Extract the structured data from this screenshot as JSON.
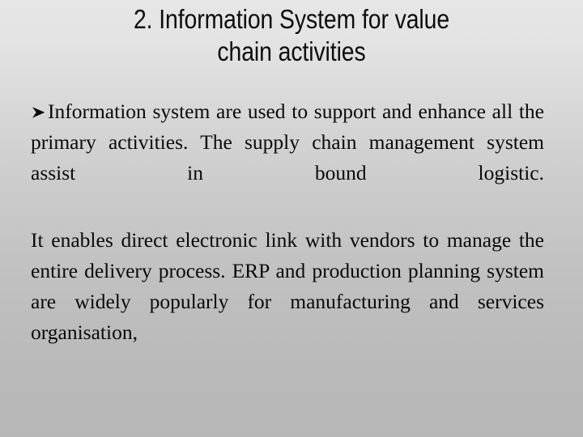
{
  "slide": {
    "background": {
      "gradient_from": "#e6e6e6",
      "gradient_to": "#b7b7b7",
      "direction": "top-to-bottom"
    },
    "text_color": "#0a0a0a",
    "title_color": "#0d0d0d"
  },
  "title": {
    "line1": "2. Information System for value",
    "line2": "chain activities",
    "full": "2. Information System for value chain activities"
  },
  "body": {
    "bullet_icon": "arrowhead-bullet-icon",
    "paragraphs": [
      {
        "id": "p1",
        "has_bullet": true,
        "text": "Information system are used to support and enhance all the primary activities. The supply chain management system assist in bound logistic."
      },
      {
        "id": "p2",
        "has_bullet": false,
        "text": "It enables direct electronic link with vendors to manage the entire delivery process. ERP and production planning system are widely popularly for manufacturing and services organisation,"
      }
    ]
  }
}
